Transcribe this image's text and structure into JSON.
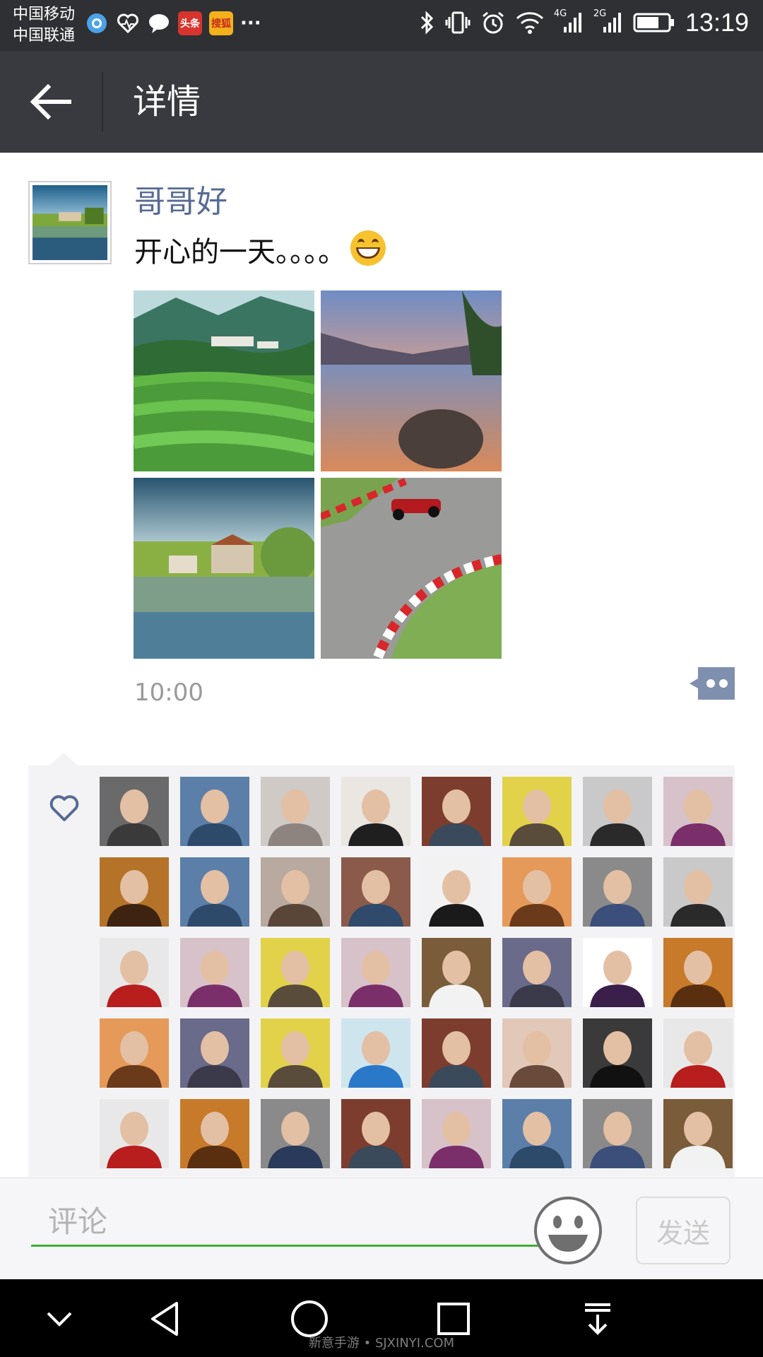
{
  "status_bar": {
    "carrier_1": "中国移动",
    "carrier_2": "中国联通",
    "network_1": "4G",
    "network_2": "2G",
    "time": "13:19",
    "notification_icons": [
      "browser-icon",
      "health-icon",
      "chat-icon",
      "toutiao-icon",
      "sougou-icon",
      "more-icon"
    ],
    "toutiao_label": "头条",
    "sougou_label": "搜狐",
    "more_label": "···"
  },
  "header": {
    "title": "详情"
  },
  "post": {
    "author": "哥哥好",
    "text": "开心的一天。。。。",
    "emoji": "grinning-face",
    "photos": [
      "tea-plantation",
      "mountain-lake-sunset",
      "lakeside-village",
      "race-car-track"
    ],
    "time": "10:00"
  },
  "likes": {
    "icon": "heart-icon",
    "avatars": [
      "avatar-1",
      "avatar-2",
      "avatar-3",
      "avatar-4",
      "avatar-5",
      "avatar-6",
      "avatar-7",
      "avatar-8",
      "avatar-9",
      "avatar-10",
      "avatar-11",
      "avatar-12",
      "avatar-13",
      "avatar-14",
      "avatar-15",
      "avatar-16",
      "avatar-17",
      "avatar-18",
      "avatar-19",
      "avatar-20",
      "avatar-21",
      "avatar-22",
      "avatar-23",
      "avatar-24",
      "avatar-25",
      "avatar-26",
      "avatar-27",
      "avatar-28",
      "avatar-29",
      "avatar-30",
      "avatar-31",
      "avatar-32",
      "avatar-33",
      "avatar-34",
      "avatar-35",
      "avatar-36",
      "avatar-37",
      "avatar-38",
      "avatar-39",
      "avatar-40"
    ]
  },
  "comment_bar": {
    "placeholder": "评论",
    "send_label": "发送"
  },
  "nav": {
    "watermark": "新意手游 • SJXINYI.COM"
  },
  "colors": {
    "accent_green": "#3cb034",
    "name_blue": "#576b95",
    "title_bar": "#393a3f"
  }
}
